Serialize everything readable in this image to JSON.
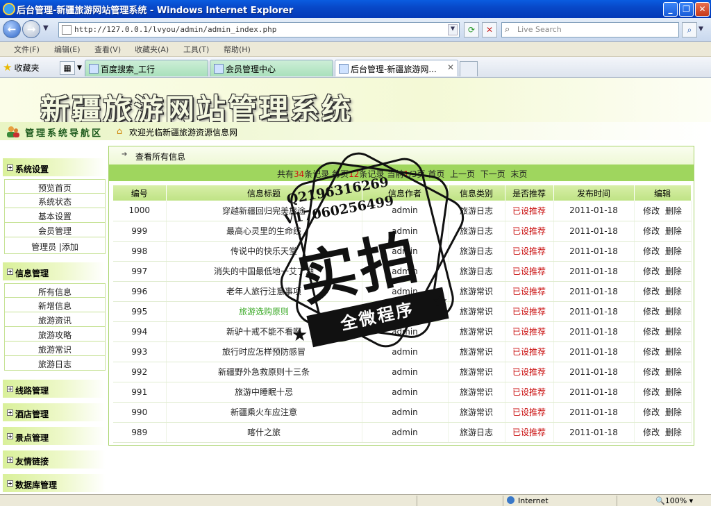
{
  "window": {
    "title": "后台管理-新疆旅游网站管理系统 - Windows Internet Explorer"
  },
  "toolbar": {
    "url": "http://127.0.0.1/lvyou/admin/admin_index.php",
    "search_placeholder": "Live Search"
  },
  "menu": [
    "文件(F)",
    "编辑(E)",
    "查看(V)",
    "收藏夹(A)",
    "工具(T)",
    "帮助(H)"
  ],
  "favorites_label": "收藏夹",
  "tabs": [
    {
      "label": "百度搜索_工行"
    },
    {
      "label": "会员管理中心"
    },
    {
      "label": "后台管理-新疆旅游网..."
    }
  ],
  "site": {
    "banner_title": "新疆旅游网站管理系统",
    "nav_heading": "管理系统导航区",
    "welcome": "欢迎光临新疆旅游资源信息网"
  },
  "sidebar": {
    "sections": [
      {
        "label": "系统设置",
        "items": [
          "预览首页",
          "系统状态",
          "基本设置",
          "会员管理",
          "管理员 |添加"
        ]
      },
      {
        "label": "信息管理",
        "items": [
          "所有信息",
          "新增信息",
          "旅游资讯",
          "旅游攻略",
          "旅游常识",
          "旅游日志"
        ]
      },
      {
        "label": "线路管理",
        "items": []
      },
      {
        "label": "酒店管理",
        "items": []
      },
      {
        "label": "景点管理",
        "items": []
      },
      {
        "label": "友情链接",
        "items": []
      },
      {
        "label": "数据库管理",
        "items": []
      }
    ]
  },
  "panel": {
    "title": "查看所有信息",
    "pager": {
      "p1": "共有",
      "total": "34",
      "p2": "条记录 每页",
      "per": "12",
      "p3": "条记录 当前",
      "cur": "1",
      "p4": "/3页",
      "links": [
        "首页",
        "上一页",
        "下一页",
        "末页"
      ]
    },
    "columns": [
      "编号",
      "信息标题",
      "信息作者",
      "信息类别",
      "是否推荐",
      "发布时间",
      "编辑"
    ],
    "rows": [
      {
        "id": "1000",
        "title": "穿越新疆回归完美旅途",
        "author": "admin",
        "category": "旅游日志",
        "recommend": "已设推荐",
        "date": "2011-01-18"
      },
      {
        "id": "999",
        "title": "最高心灵里的生命线",
        "author": "admin",
        "category": "旅游日志",
        "recommend": "已设推荐",
        "date": "2011-01-18"
      },
      {
        "id": "998",
        "title": "传说中的快乐天堂",
        "author": "admin",
        "category": "旅游日志",
        "recommend": "已设推荐",
        "date": "2011-01-18"
      },
      {
        "id": "997",
        "title": "消失的中国最低地一艾丁湖",
        "author": "admin",
        "category": "旅游日志",
        "recommend": "已设推荐",
        "date": "2011-01-18"
      },
      {
        "id": "996",
        "title": "老年人旅行注意事项",
        "author": "admin",
        "category": "旅游常识",
        "recommend": "已设推荐",
        "date": "2011-01-18"
      },
      {
        "id": "995",
        "title": "旅游选购原则",
        "author": "admin",
        "category": "旅游常识",
        "recommend": "已设推荐",
        "date": "2011-01-18"
      },
      {
        "id": "994",
        "title": "新驴十戒不能不看啊",
        "author": "admin",
        "category": "旅游常识",
        "recommend": "已设推荐",
        "date": "2011-01-18"
      },
      {
        "id": "993",
        "title": "旅行时应怎样预防感冒",
        "author": "admin",
        "category": "旅游常识",
        "recommend": "已设推荐",
        "date": "2011-01-18"
      },
      {
        "id": "992",
        "title": "新疆野外急救原则十三条",
        "author": "admin",
        "category": "旅游常识",
        "recommend": "已设推荐",
        "date": "2011-01-18"
      },
      {
        "id": "991",
        "title": "旅游中睡眠十忌",
        "author": "admin",
        "category": "旅游常识",
        "recommend": "已设推荐",
        "date": "2011-01-18"
      },
      {
        "id": "990",
        "title": "新疆乘火车应注意",
        "author": "admin",
        "category": "旅游常识",
        "recommend": "已设推荐",
        "date": "2011-01-18"
      },
      {
        "id": "989",
        "title": "喀什之旅",
        "author": "admin",
        "category": "旅游日志",
        "recommend": "已设推荐",
        "date": "2011-01-18"
      }
    ],
    "row_actions": [
      "修改",
      "删除"
    ]
  },
  "watermark": {
    "line1": "Q2196316269",
    "line2": "V17060256499",
    "big": "实拍",
    "ribbon": "全微程序"
  },
  "status": {
    "zone": "Internet",
    "zoom": "100%"
  },
  "colors": {
    "accent_green": "#9fd65e",
    "recommend_red": "#c80a0a",
    "title_bar_blue": "#0848c8"
  },
  "icons": {
    "ie": "ie-logo-icon",
    "back": "back-arrow-icon",
    "forward": "forward-arrow-icon",
    "refresh": "refresh-icon",
    "stop": "stop-icon",
    "search": "search-icon",
    "home": "home-icon",
    "favorites": "star-icon"
  }
}
